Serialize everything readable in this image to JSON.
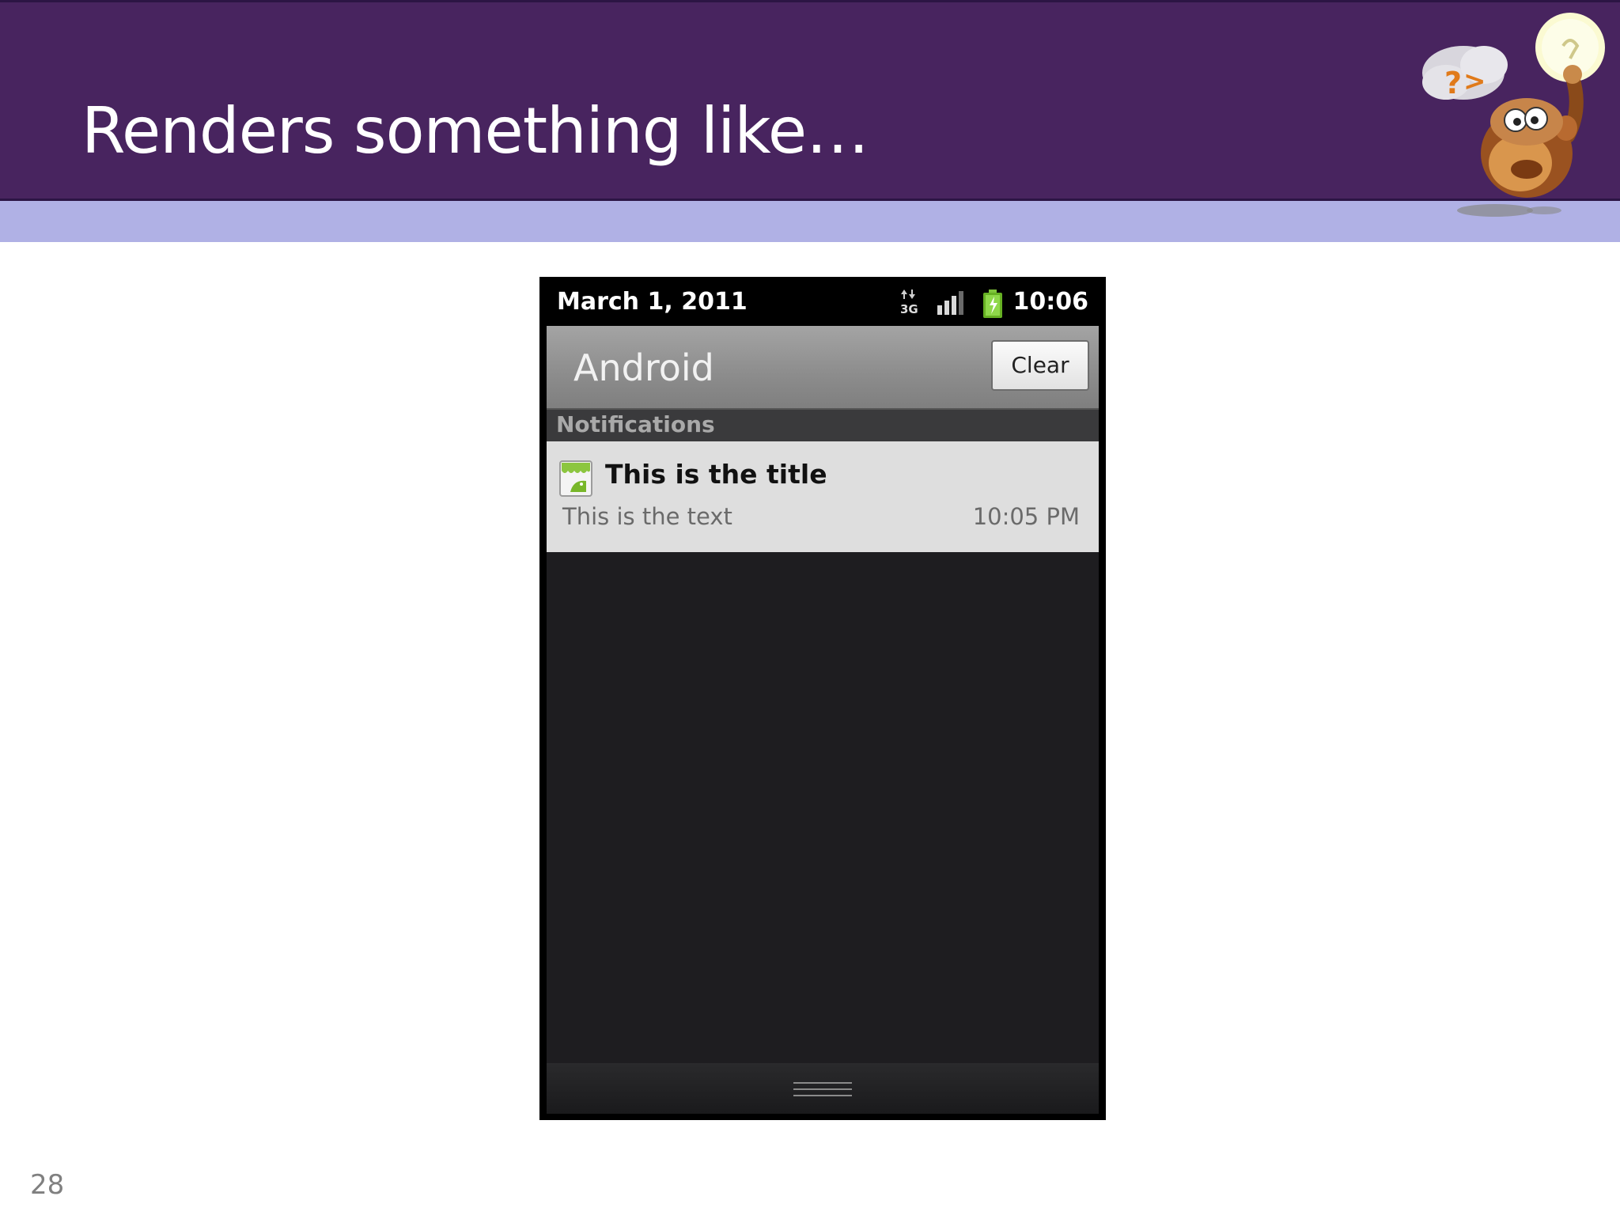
{
  "slide": {
    "title": "Renders something like…",
    "page_number": "28",
    "colors": {
      "title_bar": "#48245f",
      "stripe": "#b0b1e5",
      "background": "#ffffff"
    },
    "mascot_icon": "monkey-lightbulb-mascot-icon"
  },
  "phone": {
    "status_bar": {
      "date": "March 1, 2011",
      "time": "10:06",
      "icons": [
        "3g-data-icon",
        "signal-strength-icon",
        "battery-charging-icon"
      ]
    },
    "notification_shade": {
      "carrier_label": "Android",
      "clear_label": "Clear",
      "section_label": "Notifications",
      "notifications": [
        {
          "icon": "android-app-icon",
          "title": "This is the title",
          "text": "This is the text",
          "time": "10:05 PM"
        }
      ]
    }
  }
}
